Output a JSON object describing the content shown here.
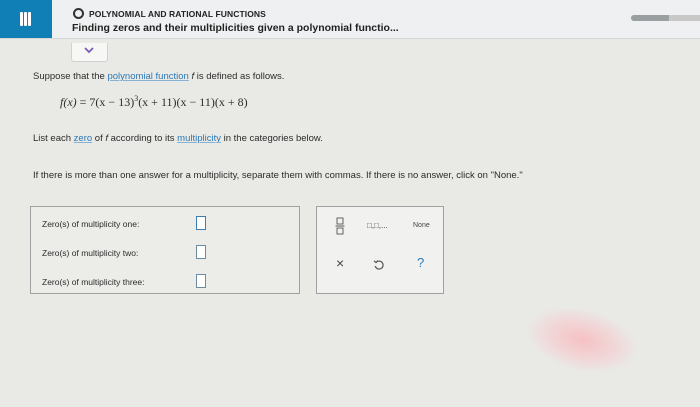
{
  "header": {
    "topic": "POLYNOMIAL AND RATIONAL FUNCTIONS",
    "title": "Finding zeros and their multiplicities given a polynomial functio...",
    "progress_fraction": 0.55
  },
  "problem": {
    "p1_before": "Suppose that the ",
    "p1_link": "polynomial function",
    "p1_f": "f",
    "p1_after": " is defined as follows.",
    "formula_lhs": "f(x)",
    "formula_rhs_a": " = 7(x − 13)",
    "formula_exp": "3",
    "formula_rhs_b": "(x + 11)(x − 11)(x + 8)",
    "p2_a": "List each ",
    "p2_link_zero": "zero",
    "p2_b": " of ",
    "p2_f": "f",
    "p2_c": " according to its ",
    "p2_link_mult": "multiplicity",
    "p2_d": " in the categories below.",
    "p3": "If there is more than one answer for a multiplicity, separate them with commas. If there is no answer, click on \"None.\""
  },
  "answers": [
    {
      "label": "Zero(s) of multiplicity one:",
      "value": ""
    },
    {
      "label": "Zero(s) of multiplicity two:",
      "value": ""
    },
    {
      "label": "Zero(s) of multiplicity three:",
      "value": ""
    }
  ],
  "tools": {
    "fraction_icon": "fraction-icon",
    "list_icon": "comma-list-icon",
    "list_label": "□,□,...",
    "none_label": "None",
    "clear_symbol": "×",
    "undo_icon": "undo-icon",
    "help_symbol": "?"
  },
  "colors": {
    "accent": "#0f7fb5",
    "link": "#2b79b6",
    "help": "#2b79b6"
  }
}
